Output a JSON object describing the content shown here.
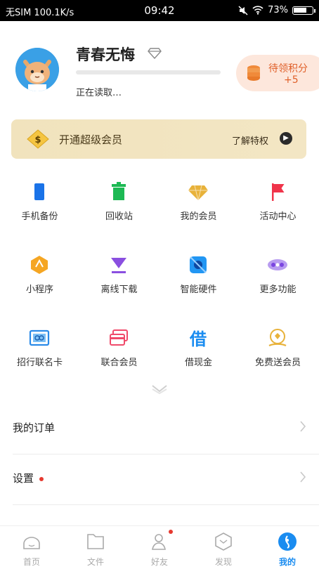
{
  "status_bar": {
    "carrier": "无SIM 100.1K/s",
    "time": "09:42",
    "battery": "73%",
    "battery_level": 0.73
  },
  "profile": {
    "username": "青春无悔",
    "status": "正在读取…"
  },
  "points": {
    "label": "待领积分",
    "value": "+5"
  },
  "vip_banner": {
    "title": "开通超级会员",
    "link": "了解特权"
  },
  "grid": [
    {
      "label": "手机备份",
      "icon": "phone-backup-icon",
      "color": "#1a73e8"
    },
    {
      "label": "回收站",
      "icon": "recycle-bin-icon",
      "color": "#1db954"
    },
    {
      "label": "我的会员",
      "icon": "diamond-icon",
      "color": "#e8b23a"
    },
    {
      "label": "活动中心",
      "icon": "flag-icon",
      "color": "#f0344a"
    },
    {
      "label": "小程序",
      "icon": "hexagon-icon",
      "color": "#f5a623"
    },
    {
      "label": "离线下载",
      "icon": "download-icon",
      "color": "#8a4fe0"
    },
    {
      "label": "智能硬件",
      "icon": "hardware-icon",
      "color": "#2196f3"
    },
    {
      "label": "更多功能",
      "icon": "more-icon",
      "color": "#8a55e8"
    },
    {
      "label": "招行联名卡",
      "icon": "card-icon",
      "color": "#2b8be8"
    },
    {
      "label": "联合会员",
      "icon": "union-card-icon",
      "color": "#f04a6a"
    },
    {
      "label": "借现金",
      "icon": "borrow-icon",
      "icon_text": "借",
      "color": "#1a8cf0"
    },
    {
      "label": "免费送会员",
      "icon": "gift-member-icon",
      "color": "#e8b23a"
    }
  ],
  "list": [
    {
      "label": "我的订单",
      "dot": false
    },
    {
      "label": "设置",
      "dot": true
    }
  ],
  "tabs": [
    {
      "label": "首页",
      "icon": "home-icon",
      "active": false,
      "dot": false
    },
    {
      "label": "文件",
      "icon": "folder-icon",
      "active": false,
      "dot": false
    },
    {
      "label": "好友",
      "icon": "friends-icon",
      "active": false,
      "dot": true
    },
    {
      "label": "发现",
      "icon": "discover-icon",
      "active": false,
      "dot": false
    },
    {
      "label": "我的",
      "icon": "mine-icon",
      "active": true,
      "dot": false
    }
  ],
  "colors": {
    "accent": "#1a8cf0",
    "points_text": "#e0602a",
    "vip_bg": "#f1e3bd"
  }
}
